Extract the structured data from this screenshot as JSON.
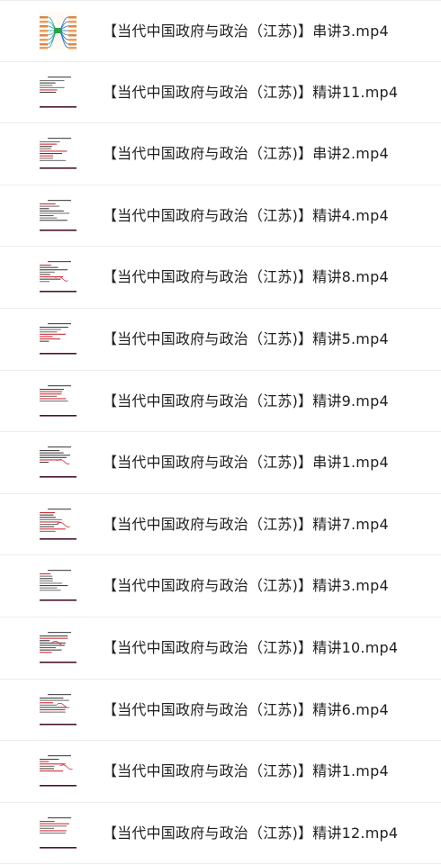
{
  "files": [
    {
      "name": "【当代中国政府与政治（江苏)】串讲3.mp4",
      "thumb": "mindmap-thumbnail"
    },
    {
      "name": "【当代中国政府与政治（江苏)】精讲11.mp4",
      "thumb": "slide-thumbnail"
    },
    {
      "name": "【当代中国政府与政治（江苏)】串讲2.mp4",
      "thumb": "slide-thumbnail"
    },
    {
      "name": "【当代中国政府与政治（江苏)】精讲4.mp4",
      "thumb": "slide-thumbnail"
    },
    {
      "name": "【当代中国政府与政治（江苏)】精讲8.mp4",
      "thumb": "slide-thumbnail"
    },
    {
      "name": "【当代中国政府与政治（江苏)】精讲5.mp4",
      "thumb": "slide-thumbnail"
    },
    {
      "name": "【当代中国政府与政治（江苏)】精讲9.mp4",
      "thumb": "slide-thumbnail"
    },
    {
      "name": "【当代中国政府与政治（江苏)】串讲1.mp4",
      "thumb": "slide-thumbnail"
    },
    {
      "name": "【当代中国政府与政治（江苏)】精讲7.mp4",
      "thumb": "slide-thumbnail"
    },
    {
      "name": "【当代中国政府与政治（江苏)】精讲3.mp4",
      "thumb": "slide-thumbnail"
    },
    {
      "name": "【当代中国政府与政治（江苏)】精讲10.mp4",
      "thumb": "slide-thumbnail"
    },
    {
      "name": "【当代中国政府与政治（江苏)】精讲6.mp4",
      "thumb": "slide-thumbnail"
    },
    {
      "name": "【当代中国政府与政治（江苏)】精讲1.mp4",
      "thumb": "slide-thumbnail"
    },
    {
      "name": "【当代中国政府与政治（江苏)】精讲12.mp4",
      "thumb": "slide-thumbnail"
    }
  ]
}
